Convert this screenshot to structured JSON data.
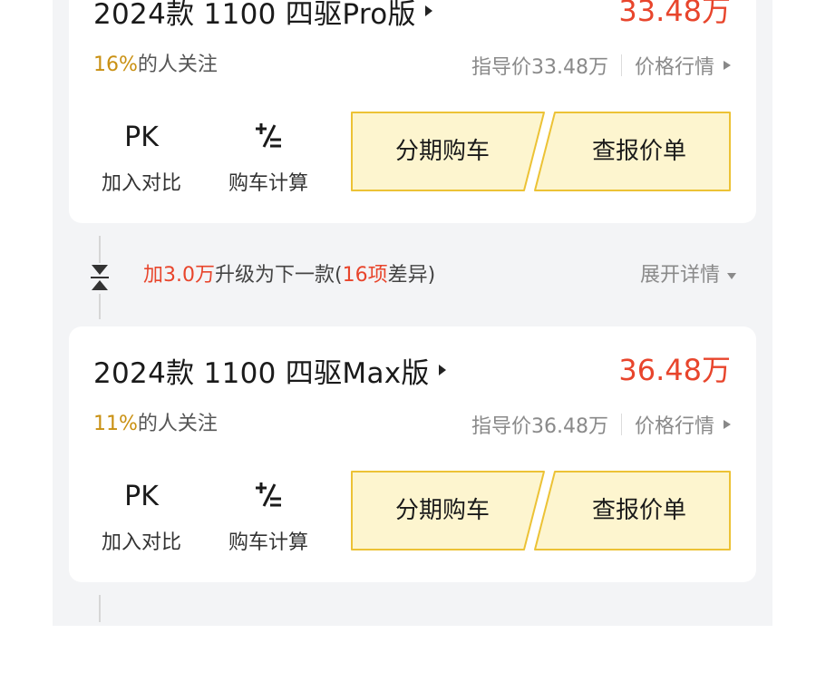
{
  "colors": {
    "price_red": "#e8452c",
    "attention_gold": "#c99012",
    "button_fill": "#fdf5cf",
    "button_border": "#ecc235",
    "panel_bg": "#f3f4f6"
  },
  "cards": [
    {
      "name": "2024款 1100 四驱Pro版",
      "price": "33.48万",
      "attention_percent": "16%",
      "attention_suffix": "的人关注",
      "guide_price": "指导价33.48万",
      "market_label": "价格行情",
      "pk_icon": "PK",
      "pk_label": "加入对比",
      "calc_label": "购车计算",
      "installment_label": "分期购车",
      "quote_label": "查报价单"
    },
    {
      "name": "2024款 1100 四驱Max版",
      "price": "36.48万",
      "attention_percent": "11%",
      "attention_suffix": "的人关注",
      "guide_price": "指导价36.48万",
      "market_label": "价格行情",
      "pk_icon": "PK",
      "pk_label": "加入对比",
      "calc_label": "购车计算",
      "installment_label": "分期购车",
      "quote_label": "查报价单"
    }
  ],
  "upgrade": {
    "prefix": "加3.0万",
    "middle": "升级为下一款(",
    "count": "16项",
    "suffix": "差异)",
    "expand_label": "展开详情"
  }
}
